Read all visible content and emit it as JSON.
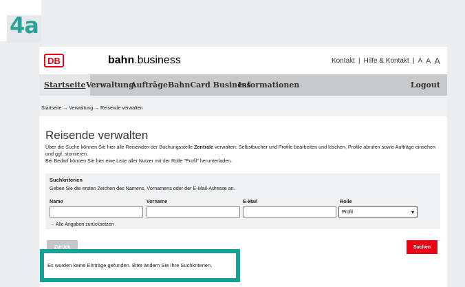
{
  "step": {
    "label": "4a"
  },
  "header": {
    "logo": "DB",
    "brand_bold": "bahn",
    "brand_dot": ".",
    "brand_rest": "business",
    "links": [
      "Kontakt",
      "Hilfe & Kontakt"
    ],
    "font_sizes": [
      "A",
      "A",
      "A"
    ]
  },
  "nav": {
    "items": [
      "Startseite",
      "Verwaltung",
      "Aufträge",
      "BahnCard Business",
      "Informationen"
    ],
    "logout": "Logout"
  },
  "breadcrumb": "Startseite → Verwaltung → Reisende verwalten",
  "page": {
    "title": "Reisende verwalten",
    "intro_part1": "Über die Suche können Sie hier alle Reisenden der Buchungsstelle ",
    "intro_bold": "Zentrale",
    "intro_part2": " verwalten: Selbstbucher und Profile bearbeiten und löschen, Profile abrufen sowie Aufträge einsehen und ggf. stornieren.",
    "intro_line2": "Bei Bedarf können Sie hier eine Liste aller Nutzer mit der Rolle \"Profil\" herunterladen."
  },
  "search": {
    "title": "Suchkriterien",
    "hint": "Geben Sie die ersten Zeichen des Namens, Vornamens oder der E-Mail-Adresse an.",
    "columns": [
      "Name",
      "Vorname",
      "E-Mail",
      "Rolle"
    ],
    "name_value": "",
    "vorname_value": "",
    "email_value": "",
    "role_selected": "Profil",
    "reset_label": "Alle Angaben zurücksetzen"
  },
  "buttons": {
    "back": "Zurück",
    "search": "Suchen"
  },
  "message": "Es wurden keine Einträge gefunden. Bitte ändern Sie Ihre Suchkriterien.",
  "colors": {
    "brand_red": "#ec0016",
    "highlight_teal": "#17a096",
    "step_teal": "#2ba39a"
  }
}
